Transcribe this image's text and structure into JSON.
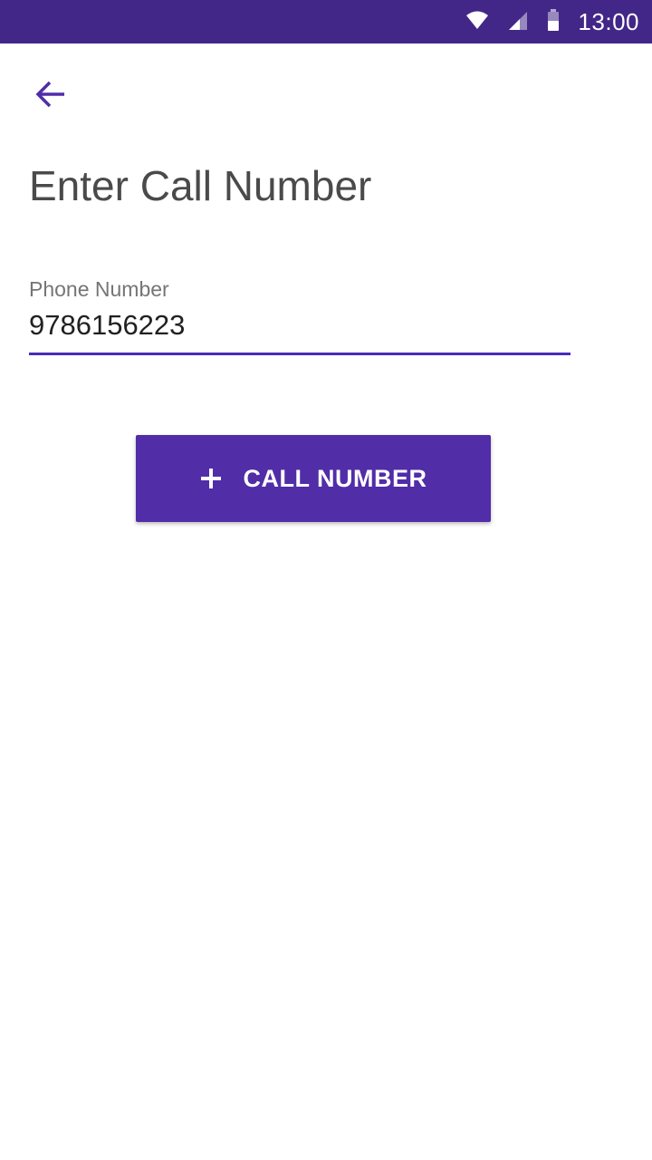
{
  "status_bar": {
    "time": "13:00",
    "icons": [
      "wifi-icon",
      "signal-icon",
      "battery-icon"
    ],
    "background": "#432788"
  },
  "header": {
    "back_icon": "arrow-back-icon",
    "title": "Enter Call Number"
  },
  "form": {
    "phone_label": "Phone Number",
    "phone_value": "9786156223"
  },
  "actions": {
    "call_icon": "plus-icon",
    "call_label": "CALL NUMBER"
  },
  "colors": {
    "accent": "#512da8",
    "underline": "#4a2bbd",
    "title_text": "#4a4a4a",
    "label_text": "#757575"
  }
}
